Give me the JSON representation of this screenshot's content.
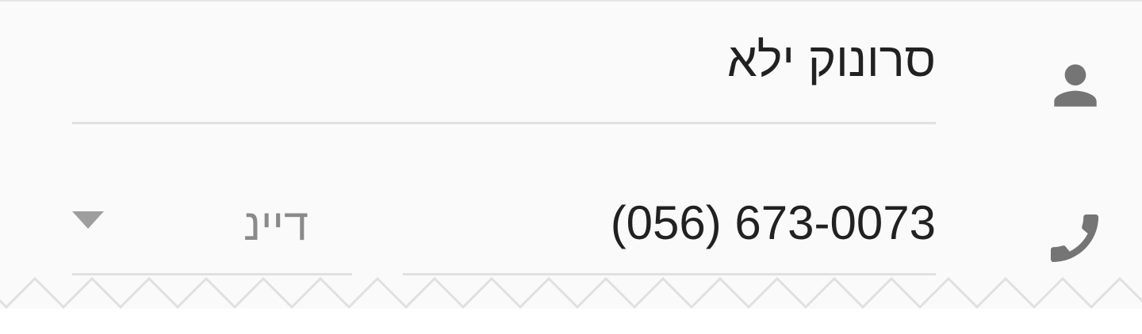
{
  "contact": {
    "name": {
      "icon": "person-icon",
      "value": "סרונוק ילא"
    },
    "phone": {
      "icon": "phone-icon",
      "value": "(056) 673-0073",
      "type_value": "דיינ",
      "type_dropdown_icon": "dropdown-arrow-icon"
    }
  },
  "colors": {
    "background": "#fafafa",
    "icon": "#757575",
    "text": "#212121",
    "secondary_text": "#8a8a8a",
    "divider": "#e0e0e0"
  }
}
